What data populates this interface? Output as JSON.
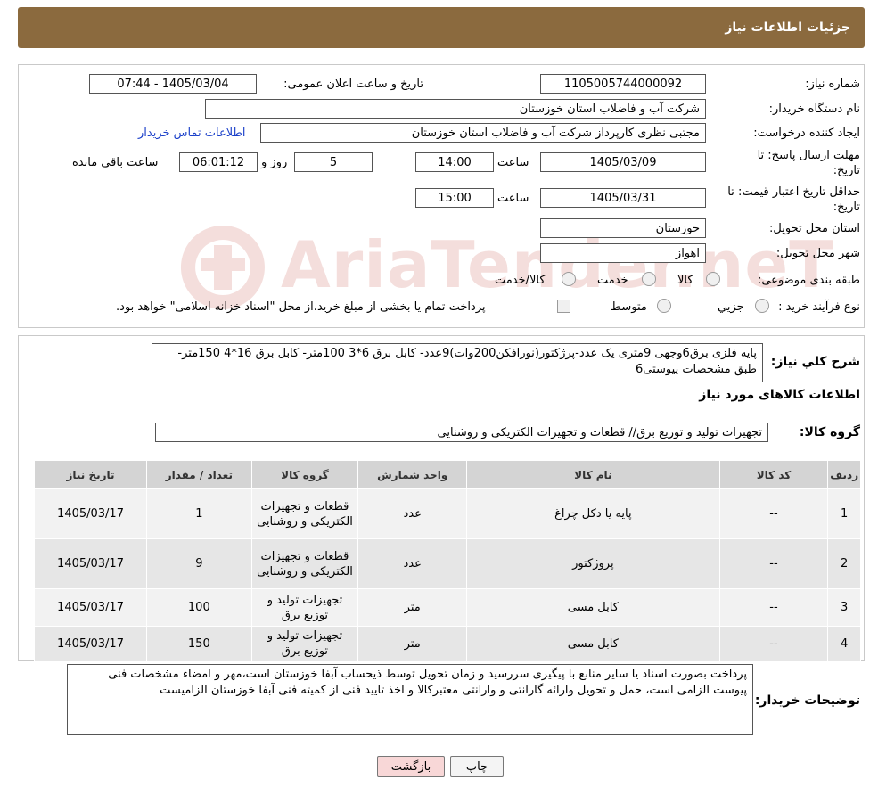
{
  "header": {
    "title": "جزئیات اطلاعات نیاز"
  },
  "form": {
    "need_number_label": "شماره نیاز:",
    "need_number": "1105005744000092",
    "announce_label": "تاریخ و ساعت اعلان عمومی:",
    "announce_value": "1405/03/04 - 07:44",
    "buyer_org_label": "نام دستگاه خریدار:",
    "buyer_org": "شرکت آب و فاضلاب استان خوزستان",
    "creator_label": "ایجاد کننده درخواست:",
    "creator": "مجتبی نظری کارپرداز شرکت آب و فاضلاب استان خوزستان",
    "contact_link": "اطلاعات تماس خریدار",
    "deadline_label_1": "مهلت ارسال پاسخ: تا",
    "deadline_label_2": "تاریخ:",
    "deadline_date": "1405/03/09",
    "time_label": "ساعت",
    "deadline_time": "14:00",
    "days_value": "5",
    "days_label": "روز و",
    "remaining_time": "06:01:12",
    "remaining_label": "ساعت باقي مانده",
    "validity_label_1": "حداقل تاریخ اعتبار قیمت: تا",
    "validity_label_2": "تاریخ:",
    "validity_date": "1405/03/31",
    "validity_time": "15:00",
    "province_label": "استان محل تحویل:",
    "province": "خوزستان",
    "city_label": "شهر محل تحویل:",
    "city": "اهواز",
    "category_label": "طبقه بندی موضوعی:",
    "category_options": [
      "کالا",
      "خدمت",
      "کالا/خدمت"
    ],
    "process_label": "نوع فرآیند خرید :",
    "process_options": [
      "جزیي",
      "متوسط"
    ],
    "payment_note": "پرداخت تمام یا بخشی از مبلغ خرید،از محل \"اسناد خزانه اسلامی\" خواهد بود."
  },
  "description": {
    "label": "شرح كلي نياز:",
    "text": "پایه فلزی برق6وجهی 9متری یک عدد-پرژکتور(نورافکن200وات)9عدد- کابل برق 6*3  100متر- کابل برق 16*4 150متر-طبق مشخصات پیوستی6"
  },
  "goods": {
    "section_title": "اطلاعات کالاهای مورد نیاز",
    "group_label": "گروه کالا:",
    "group_value": "تجهیزات تولید و توزیع برق// قطعات و تجهیزات الکتریکی و روشنایی",
    "columns": [
      "ردیف",
      "کد کالا",
      "نام کالا",
      "واحد شمارش",
      "گروه کالا",
      "تعداد / مقدار",
      "تاریخ نیاز"
    ],
    "rows": [
      {
        "row": "1",
        "code": "--",
        "name": "پایه یا دکل چراغ",
        "unit": "عدد",
        "group": "قطعات و تجهیزات الکتریکی و روشنایی",
        "qty": "1",
        "date": "1405/03/17"
      },
      {
        "row": "2",
        "code": "--",
        "name": "پروژکتور",
        "unit": "عدد",
        "group": "قطعات و تجهیزات الکتریکی و روشنایی",
        "qty": "9",
        "date": "1405/03/17"
      },
      {
        "row": "3",
        "code": "--",
        "name": "کابل مسی",
        "unit": "متر",
        "group": "تجهیزات تولید و توزیع برق",
        "qty": "100",
        "date": "1405/03/17"
      },
      {
        "row": "4",
        "code": "--",
        "name": "کابل مسی",
        "unit": "متر",
        "group": "تجهیزات تولید و توزیع برق",
        "qty": "150",
        "date": "1405/03/17"
      }
    ]
  },
  "buyer_notes": {
    "label": "توضیحات خریدار:",
    "text": "پرداخت بصورت اسناد یا سایر منابع با پیگیری  سررسید و زمان تحویل توسط ذیحساب آبفا خوزستان است،مهر و امضاء مشخصات فنی پیوست الزامی است، حمل و تحویل وارائه گارانتی و وارانتی معتبرکالا و اخذ تایید فنی از کمیته فنی آبفا خوزستان الزامیست"
  },
  "buttons": {
    "print": "چاپ",
    "back": "بازگشت"
  },
  "watermark": {
    "text": "AriaTender.neT"
  },
  "colors": {
    "header_bg": "#8b6a3e",
    "link": "#1a3fc9",
    "back_bg": "#f8d7d7",
    "table_header": "#d4d4d4"
  }
}
